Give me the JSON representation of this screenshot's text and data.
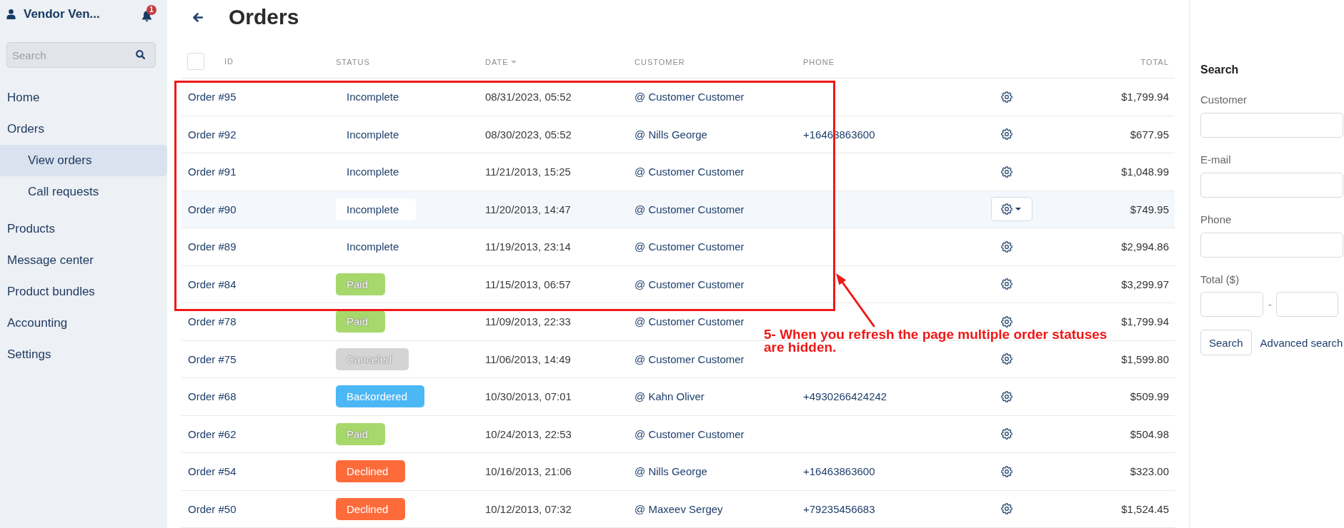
{
  "sidebar": {
    "user_name": "Vendor Ven...",
    "notification_count": "1",
    "search": {
      "placeholder": "Search"
    },
    "items": [
      {
        "label": "Home",
        "selected": false
      },
      {
        "label": "Orders",
        "selected": false,
        "children": [
          {
            "label": "View orders",
            "selected": true
          },
          {
            "label": "Call requests",
            "selected": false
          }
        ]
      },
      {
        "label": "Products",
        "selected": false
      },
      {
        "label": "Message center",
        "selected": false
      },
      {
        "label": "Product bundles",
        "selected": false
      },
      {
        "label": "Accounting",
        "selected": false
      },
      {
        "label": "Settings",
        "selected": false
      }
    ]
  },
  "page": {
    "title": "Orders"
  },
  "table": {
    "select_all": {
      "checked": false
    },
    "columns": [
      {
        "label": "ID",
        "sorted": false
      },
      {
        "label": "STATUS",
        "sorted": false
      },
      {
        "label": "DATE",
        "sorted": true
      },
      {
        "label": "CUSTOMER",
        "sorted": false
      },
      {
        "label": "PHONE",
        "sorted": false
      },
      {
        "label": "TOTAL",
        "sorted": false
      }
    ],
    "rows": [
      {
        "id": "Order #95",
        "status": {
          "label": "Incomplete",
          "color": "#ffffff"
        },
        "date": "08/31/2023, 05:52",
        "customer": "@ Customer Customer",
        "total": "$1,799.94",
        "hovered": false
      },
      {
        "id": "Order #92",
        "status": {
          "label": "Incomplete",
          "color": "#ffffff"
        },
        "date": "08/30/2023, 05:52",
        "customer": "@ Nills George",
        "phone": "+16463863600",
        "total": "$677.95",
        "hovered": false
      },
      {
        "id": "Order #91",
        "status": {
          "label": "Incomplete",
          "color": "#ffffff"
        },
        "date": "11/21/2013, 15:25",
        "customer": "@ Customer Customer",
        "total": "$1,048.99",
        "hovered": false
      },
      {
        "id": "Order #90",
        "status": {
          "label": "Incomplete",
          "color": "#ffffff"
        },
        "date": "11/20/2013, 14:47",
        "customer": "@ Customer Customer",
        "total": "$749.95",
        "hovered": true
      },
      {
        "id": "Order #89",
        "status": {
          "label": "Incomplete",
          "color": "#ffffff"
        },
        "date": "11/19/2013, 23:14",
        "customer": "@ Customer Customer",
        "total": "$2,994.86",
        "hovered": false
      },
      {
        "id": "Order #84",
        "status": {
          "label": "Paid",
          "color": "#a7d86c"
        },
        "date": "11/15/2013, 06:57",
        "customer": "@ Customer Customer",
        "total": "$3,299.97",
        "hovered": false
      },
      {
        "id": "Order #78",
        "status": {
          "label": "Paid",
          "color": "#a7d86c"
        },
        "date": "11/09/2013, 22:33",
        "customer": "@ Customer Customer",
        "total": "$1,799.94",
        "hovered": false
      },
      {
        "id": "Order #75",
        "status": {
          "label": "Canceled",
          "color": "#d4d4d4"
        },
        "date": "11/06/2013, 14:49",
        "customer": "@ Customer Customer",
        "total": "$1,599.80",
        "hovered": false
      },
      {
        "id": "Order #68",
        "status": {
          "label": "Backordered",
          "color": "#4cb7f5"
        },
        "date": "10/30/2013, 07:01",
        "customer": "@ Kahn Oliver",
        "phone": "+4930266424242",
        "total": "$509.99",
        "hovered": false
      },
      {
        "id": "Order #62",
        "status": {
          "label": "Paid",
          "color": "#a7d86c"
        },
        "date": "10/24/2013, 22:53",
        "customer": "@ Customer Customer",
        "total": "$504.98",
        "hovered": false
      },
      {
        "id": "Order #54",
        "status": {
          "label": "Declined",
          "color": "#fe6b3b"
        },
        "date": "10/16/2013, 21:06",
        "customer": "@ Nills George",
        "phone": "+16463863600",
        "total": "$323.00",
        "hovered": false
      },
      {
        "id": "Order #50",
        "status": {
          "label": "Declined",
          "color": "#fe6b3b"
        },
        "date": "10/12/2013, 07:32",
        "customer": "@ Maxeev Sergey",
        "phone": "+79235456683",
        "total": "$1,524.45",
        "hovered": false
      }
    ]
  },
  "search_panel": {
    "title": "Search",
    "fields": [
      {
        "label": "Customer"
      },
      {
        "label": "E-mail"
      },
      {
        "label": "Phone"
      }
    ],
    "total": {
      "label": "Total ($)",
      "separator": "-"
    },
    "search_button": "Search",
    "advanced_link": "Advanced search"
  },
  "annotation": {
    "text": "5- When you refresh the page multiple order statuses are hidden."
  }
}
